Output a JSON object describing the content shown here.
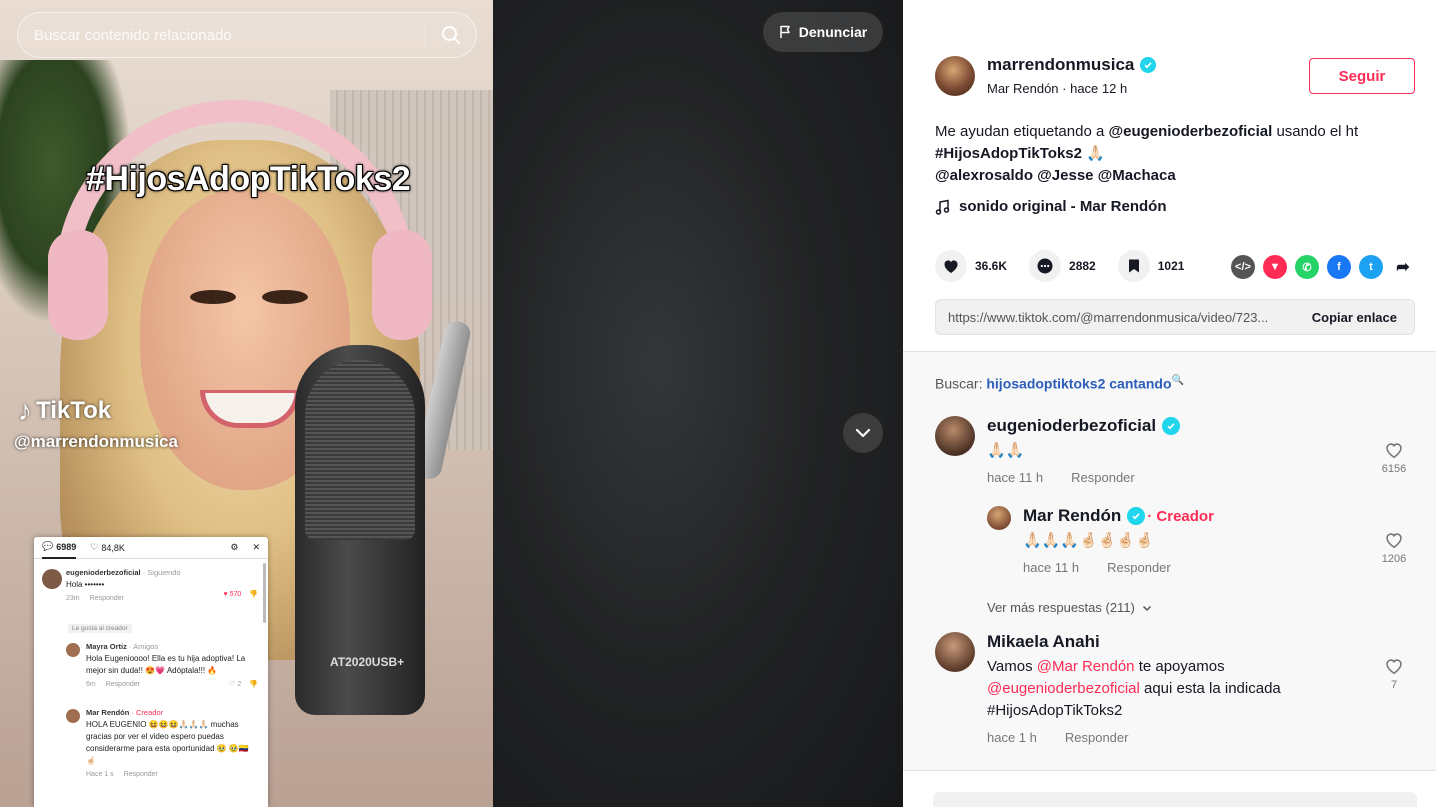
{
  "video": {
    "search_placeholder": "Buscar contenido relacionado",
    "report_label": "Denunciar",
    "overlay_hashtag": "#HijosAdopTikToks2",
    "watermark_brand": "TikTok",
    "watermark_user": "@marrendonmusica",
    "mic_text": "AT2020USB+",
    "embedded_comments": {
      "comment_count": "6989",
      "like_count": "84,8K",
      "items": [
        {
          "user": "eugenioderbezoficial",
          "badge": "· Siguiendo",
          "text": "Hola •••••••",
          "time": "23m",
          "reply": "Responder",
          "likes": "570",
          "chip": "Le gusta al creador"
        },
        {
          "user": "Mayra Ortiz",
          "badge": "· Amigos",
          "text": "Hola Eugenioooo! Ella es tu hija adoptiva! La mejor sin duda!! 😍💗 Adóptala!!! 🔥",
          "time": "6m",
          "reply": "Responder",
          "likes": "2"
        },
        {
          "user": "Mar Rendón",
          "badge": "· Creador",
          "text": "HOLA EUGENIO 😆😆😆🙏🏻🙏🏻🙏🏻 muchas gracias por ver el video espero puedas considerarme para esta oportunidad 🥹 🥹🇨🇴☝🏻",
          "time": "Hace 1 s",
          "reply": "Responder"
        }
      ]
    }
  },
  "author": {
    "username": "marrendonmusica",
    "subtitle": "Mar Rendón · hace 12 h",
    "follow_label": "Seguir"
  },
  "description": {
    "line1_prefix": "Me ayudan etiquetando a ",
    "line1_mention": "@eugenioderbezoficial",
    "line1_suffix": " usando el ht",
    "line2": "#HijosAdopTikToks2 🙏🏻",
    "line3": "@alexrosaldo @Jesse @Machaca"
  },
  "sound": "sonido original - Mar Rendón",
  "stats": {
    "likes": "36.6K",
    "comments": "2882",
    "saves": "1021"
  },
  "share_icons": [
    "embed-icon",
    "send-icon",
    "whatsapp-icon",
    "facebook-icon",
    "twitter-icon",
    "share-arrow-icon"
  ],
  "link": {
    "url": "https://www.tiktok.com/@marrendonmusica/video/723...",
    "copy_label": "Copiar enlace"
  },
  "related_search": {
    "prefix": "Buscar: ",
    "query": "hijosadoptiktoks2 cantando"
  },
  "comments": [
    {
      "user": "eugenioderbezoficial",
      "text": "🙏🏻🙏🏻",
      "time": "hace 11 h",
      "reply": "Responder",
      "likes": "6156"
    },
    {
      "user": "Mar Rendón",
      "creator": "· Creador",
      "text": "🙏🏻🙏🏻🙏🏻🤞🏻🤞🏻🤞🏻🤞🏻",
      "time": "hace 11 h",
      "reply": "Responder",
      "likes": "1206"
    },
    {
      "user": "Mikaela Anahi",
      "mention1": "@Mar Rendón",
      "mid": " te apoyamos",
      "mention2": "@eugenioderbezoficial",
      "tail": " aqui esta la indicada",
      "hashtag": "#HijosAdopTikToks2",
      "prefix": "Vamos ",
      "time": "hace 1 h",
      "reply": "Responder",
      "likes": "7"
    }
  ],
  "more_replies": "Ver más respuestas (211)",
  "colors": {
    "accent": "#fe2c55",
    "verified": "#20d5ec",
    "link_blue": "#2b5db9"
  }
}
